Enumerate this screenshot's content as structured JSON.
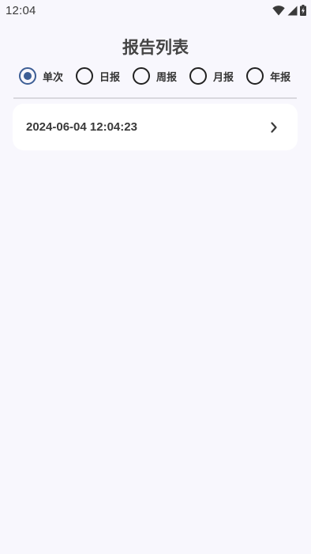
{
  "status_bar": {
    "time": "12:04",
    "icons": [
      "wifi-icon",
      "cellular-signal-icon",
      "battery-charging-icon"
    ]
  },
  "page": {
    "title": "报告列表"
  },
  "report_types": {
    "selected": "单次",
    "options": [
      {
        "label": "单次",
        "checked": true
      },
      {
        "label": "日报",
        "checked": false
      },
      {
        "label": "周报",
        "checked": false
      },
      {
        "label": "月报",
        "checked": false
      },
      {
        "label": "年报",
        "checked": false
      }
    ]
  },
  "reports": [
    {
      "datetime": "2024-06-04 12:04:23",
      "icon": "chevron-right-icon"
    }
  ],
  "colors": {
    "background": "#f8f7fd",
    "accent": "#3d5e95",
    "card": "#ffffff"
  }
}
